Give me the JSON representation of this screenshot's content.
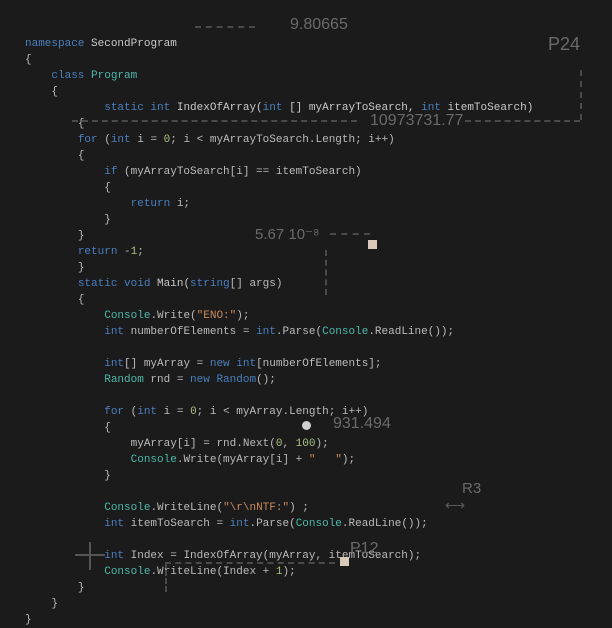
{
  "code": {
    "l1": "namespace",
    "l1b": "SecondProgram",
    "l3": "class",
    "l3b": "Program",
    "l5a": "static int",
    "l5b": "IndexOfArray(",
    "l5c": "int",
    "l5d": " [] myArrayToSearch, ",
    "l5e": "int",
    "l5f": " itemToSearch)",
    "l7a": "for",
    "l7b": " (",
    "l7c": "int",
    "l7d": " i = ",
    "l7e": "0",
    "l7f": "; i < myArrayToSearch.Length; i++)",
    "l9a": "if",
    "l9b": " (myArrayToSearch[i] == itemToSearch)",
    "l11a": "return",
    "l11b": " i;",
    "l14a": "return",
    "l14b": " -",
    "l14c": "1",
    "l14d": ";",
    "l16a": "static void",
    "l16b": " Main(",
    "l16c": "string",
    "l16d": "[] args)",
    "l18a": "Console",
    "l18b": ".Write(",
    "l18c": "\"ENO:\"",
    "l18d": ");",
    "l19a": "int",
    "l19b": " numberOfElements = ",
    "l19c": "int",
    "l19d": ".Parse(",
    "l19e": "Console",
    "l19f": ".ReadLine());",
    "l21a": "int",
    "l21b": "[] myArray = ",
    "l21c": "new int",
    "l21d": "[numberOfElements];",
    "l22a": "Random",
    "l22b": " rnd = ",
    "l22c": "new Random",
    "l22d": "();",
    "l24a": "for",
    "l24b": " (",
    "l24c": "int",
    "l24d": " i = ",
    "l24e": "0",
    "l24f": "; i < myArray.Length; i++)",
    "l26a": "myArray[i] = rnd.Next(",
    "l26b": "0",
    "l26c": ", ",
    "l26d": "100",
    "l26e": ");",
    "l27a": "Console",
    "l27b": ".Write(myArray[i] + ",
    "l27c": "\"   \"",
    "l27d": ");",
    "l29a": "Console",
    "l29b": ".WriteLine(",
    "l29c": "\"\\r\\nNTF:\"",
    "l29d": ") ;",
    "l30a": "int",
    "l30b": " itemToSearch = ",
    "l30c": "int",
    "l30d": ".Parse(",
    "l30e": "Console",
    "l30f": ".ReadLine());",
    "l32a": "int",
    "l32b": " Index = IndexOfArray(myArray, itemToSearch);",
    "l33a": "Console",
    "l33b": ".WriteLine(Index + ",
    "l33c": "1",
    "l33d": ");"
  },
  "overlays": {
    "v1": "9.80665",
    "v2": "P24",
    "v3": "10973731.77",
    "v4": "5.67 10⁻⁸",
    "v5": "931.494",
    "v6": "R3",
    "v7": "P12"
  }
}
